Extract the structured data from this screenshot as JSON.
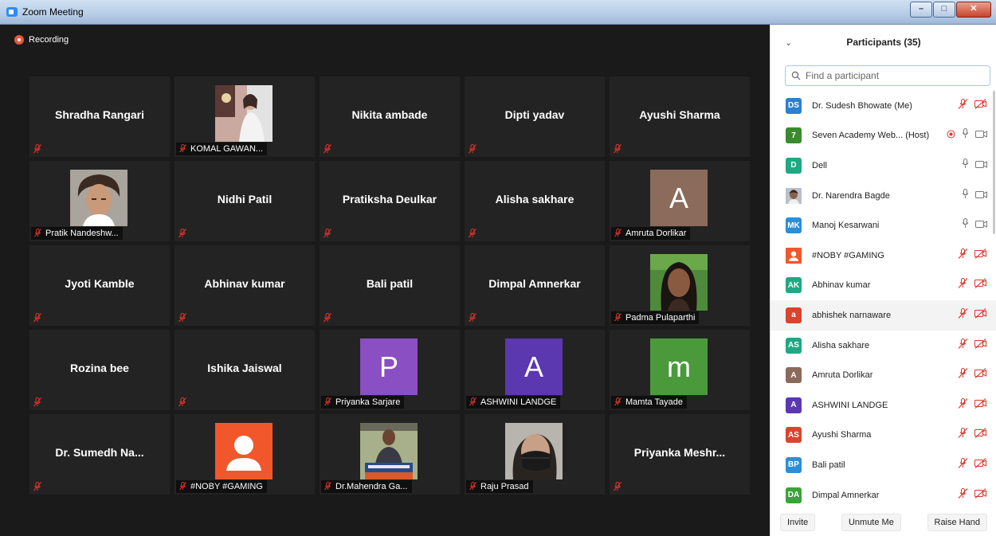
{
  "window": {
    "title": "Zoom Meeting"
  },
  "recording": {
    "label": "Recording"
  },
  "colors": {
    "muted": "#d9342b",
    "panel_accent": "#2d8cff"
  },
  "tiles": [
    {
      "name": "Shradha Rangari",
      "type": "name"
    },
    {
      "name": "KOMAL GAWAN...",
      "type": "photo",
      "photo": "bg-room"
    },
    {
      "name": "Nikita ambade",
      "type": "name"
    },
    {
      "name": "Dipti yadav",
      "type": "name"
    },
    {
      "name": "Ayushi Sharma",
      "type": "name"
    },
    {
      "name": "Pratik Nandeshw...",
      "type": "photo",
      "photo": "man-hair"
    },
    {
      "name": "Nidhi Patil",
      "type": "name"
    },
    {
      "name": "Pratiksha Deulkar",
      "type": "name"
    },
    {
      "name": "Alisha sakhare",
      "type": "name"
    },
    {
      "name": "Amruta Dorlikar",
      "type": "letter",
      "letter": "A",
      "color": "#8a6b5c"
    },
    {
      "name": "Jyoti Kamble",
      "type": "name"
    },
    {
      "name": "Abhinav kumar",
      "type": "name"
    },
    {
      "name": "Bali patil",
      "type": "name"
    },
    {
      "name": "Dimpal Amnerkar",
      "type": "name"
    },
    {
      "name": "Padma Pulaparthi",
      "type": "photo",
      "photo": "woman-green"
    },
    {
      "name": "Rozina bee",
      "type": "name"
    },
    {
      "name": "Ishika Jaiswal",
      "type": "name"
    },
    {
      "name": "Priyanka Sarjare",
      "type": "letter",
      "letter": "P",
      "color": "#8a4fc2"
    },
    {
      "name": "ASHWINI LANDGE",
      "type": "letter",
      "letter": "A",
      "color": "#5b37b0"
    },
    {
      "name": "Mamta Tayade",
      "type": "letter",
      "letter": "m",
      "color": "#4a9a3c"
    },
    {
      "name": "Dr. Sumedh Na...",
      "type": "name"
    },
    {
      "name": "#NOBY #GAMING",
      "type": "person-icon",
      "color": "#f2572c"
    },
    {
      "name": "Dr.Mahendra Ga...",
      "type": "photo",
      "photo": "man-podium"
    },
    {
      "name": "Raju Prasad",
      "type": "photo",
      "photo": "mask"
    },
    {
      "name": "Priyanka Meshr...",
      "type": "name"
    }
  ],
  "participants_panel": {
    "title": "Participants (35)",
    "search_placeholder": "Find a participant",
    "participants": [
      {
        "initials": "DS",
        "color": "#2d7fd1",
        "name": "Dr. Sudesh Bhowate (Me)",
        "audio": "muted",
        "video": "off"
      },
      {
        "initials": "7",
        "color": "#3a8a2e",
        "name": "Seven Academy Web... (Host)",
        "audio": "on",
        "video": "on-gray",
        "recording": true
      },
      {
        "initials": "D",
        "color": "#1fa883",
        "name": "Dell",
        "audio": "on",
        "video": "on-gray"
      },
      {
        "initials": "",
        "color": "#9a9a9a",
        "name": "Dr. Narendra Bagde",
        "audio": "on",
        "video": "on-gray",
        "photo": true
      },
      {
        "initials": "MK",
        "color": "#2d8ed8",
        "name": "Manoj Kesarwani",
        "audio": "on",
        "video": "on-gray"
      },
      {
        "initials": "",
        "color": "#f2572c",
        "name": "#NOBY #GAMING",
        "audio": "muted",
        "video": "off",
        "person_icon": true
      },
      {
        "initials": "AK",
        "color": "#1fa883",
        "name": "Abhinav kumar",
        "audio": "muted",
        "video": "off"
      },
      {
        "initials": "a",
        "color": "#d9442c",
        "name": "abhishek narnaware",
        "audio": "muted",
        "video": "off",
        "highlighted": true
      },
      {
        "initials": "AS",
        "color": "#1fa883",
        "name": "Alisha sakhare",
        "audio": "muted",
        "video": "off"
      },
      {
        "initials": "A",
        "color": "#8a6b5c",
        "name": "Amruta Dorlikar",
        "audio": "muted",
        "video": "off"
      },
      {
        "initials": "A",
        "color": "#5b37b0",
        "name": "ASHWINI LANDGE",
        "audio": "muted",
        "video": "off"
      },
      {
        "initials": "AS",
        "color": "#d9442c",
        "name": "Ayushi Sharma",
        "audio": "muted",
        "video": "off"
      },
      {
        "initials": "BP",
        "color": "#2d8ed8",
        "name": "Bali patil",
        "audio": "muted",
        "video": "off"
      },
      {
        "initials": "DA",
        "color": "#3aa23a",
        "name": "Dimpal Amnerkar",
        "audio": "muted",
        "video": "off"
      }
    ],
    "footer": {
      "invite": "Invite",
      "unmute": "Unmute Me",
      "raise_hand": "Raise Hand"
    }
  }
}
